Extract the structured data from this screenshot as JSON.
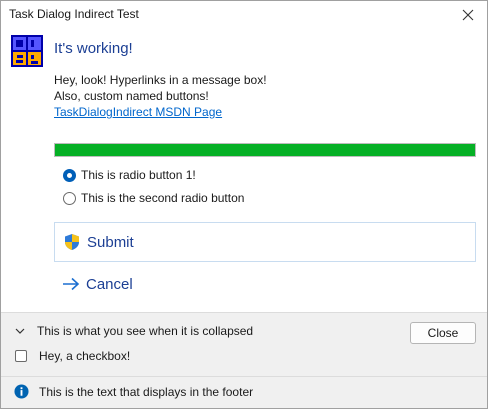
{
  "window": {
    "title": "Task Dialog Indirect Test"
  },
  "main": {
    "instruction": "It's working!",
    "content_line1": "Hey, look! Hyperlinks in a message box!",
    "content_line2": "Also, custom named buttons!",
    "link_text": "TaskDialogIndirect MSDN Page",
    "progress_percent": 100,
    "progress_color": "#06b025"
  },
  "radios": [
    {
      "label": "This is radio button 1!",
      "checked": true
    },
    {
      "label": "This is the second radio button",
      "checked": false
    }
  ],
  "command_links": [
    {
      "label": "Submit",
      "icon": "uac-shield-icon"
    },
    {
      "label": "Cancel",
      "icon": "arrow-right-icon"
    }
  ],
  "footer_area": {
    "expando_text": "This is what you see when it is collapsed",
    "close_label": "Close",
    "checkbox_label": "Hey, a checkbox!",
    "checkbox_checked": false,
    "footer_text": "This is the text that displays in the footer",
    "footer_icon": "info-icon"
  },
  "colors": {
    "accent": "#005fb8",
    "instruction": "#1c3f94",
    "link": "#0066cc"
  }
}
